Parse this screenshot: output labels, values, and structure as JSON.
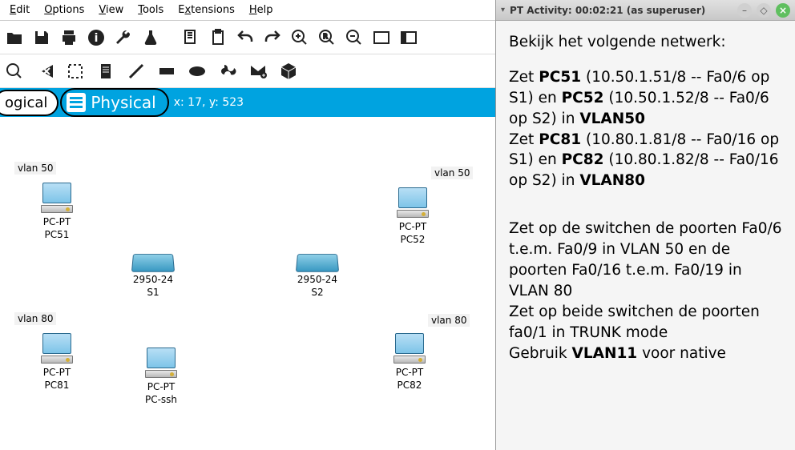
{
  "menu": {
    "edit": "Edit",
    "options": "Options",
    "view": "View",
    "tools": "Tools",
    "extensions": "Extensions",
    "help": "Help"
  },
  "tabs": {
    "logical": "ogical",
    "physical": "Physical"
  },
  "coords": "x: 17, y: 523",
  "canvas": {
    "vlan50a": "vlan 50",
    "vlan50b": "vlan 50",
    "vlan80a": "vlan 80",
    "vlan80b": "vlan 80",
    "pc51_type": "PC-PT",
    "pc51_name": "PC51",
    "pc52_type": "PC-PT",
    "pc52_name": "PC52",
    "pc81_type": "PC-PT",
    "pc81_name": "PC81",
    "pc82_type": "PC-PT",
    "pc82_name": "PC82",
    "pcssh_type": "PC-PT",
    "pcssh_name": "PC-ssh",
    "s1_type": "2950-24",
    "s1_name": "S1",
    "s2_type": "2950-24",
    "s2_name": "S2"
  },
  "side": {
    "title": "PT Activity: 00:02:21 (as superuser)",
    "l1": "Bekijk het volgende netwerk:",
    "l2a": "Zet ",
    "l2b": "PC51",
    "l2c": " (10.50.1.51/8 -- Fa0/6 op S1) en ",
    "l2d": "PC52",
    "l2e": " (10.50.1.52/8 -- Fa0/6 op S2) in ",
    "l2f": "VLAN50",
    "l3a": "Zet ",
    "l3b": "PC81",
    "l3c": " (10.80.1.81/8 -- Fa0/16 op S1) en ",
    "l3d": "PC82",
    "l3e": " (10.80.1.82/8 -- Fa0/16 op S2) in ",
    "l3f": "VLAN80",
    "l4": "Zet op de switchen de poorten Fa0/6 t.e.m. Fa0/9 in VLAN 50 en de poorten Fa0/16 t.e.m. Fa0/19 in VLAN 80",
    "l5": "Zet op beide switchen de poorten fa0/1 in TRUNK mode",
    "l6a": "Gebruik ",
    "l6b": "VLAN11",
    "l6c": " voor native"
  }
}
